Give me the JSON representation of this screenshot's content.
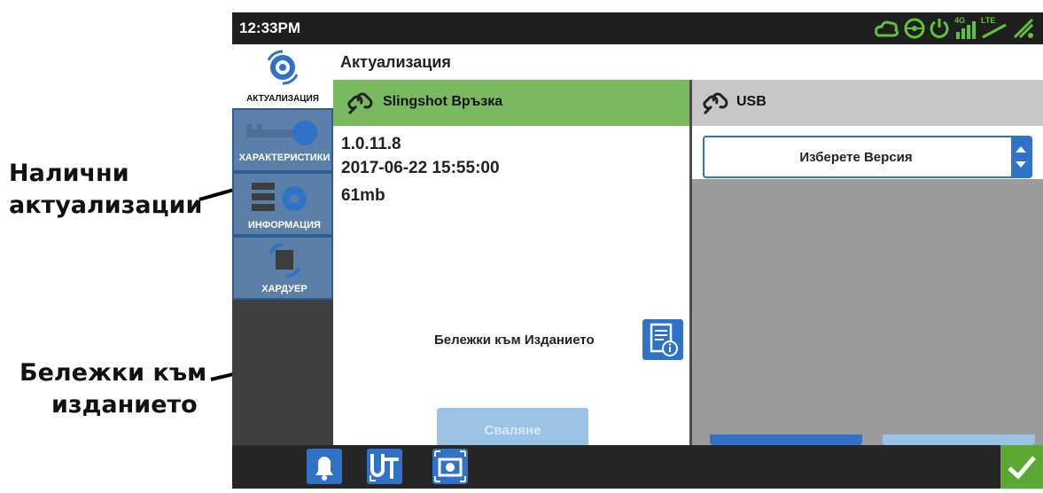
{
  "callouts": {
    "available_updates": [
      "Налични",
      "актуализации"
    ],
    "release_notes": [
      "Бележки към",
      "изданието"
    ]
  },
  "status_bar": {
    "time": "12:33PM",
    "icons": [
      "cloud-icon",
      "steering-wheel-icon",
      "power-icon",
      "signal-4g-icon",
      "lte-icon",
      "gps-icon"
    ],
    "signal_label": "4G",
    "lte_label": "LTE"
  },
  "sidebar": {
    "items": [
      {
        "label": "АКТУАЛИЗАЦИЯ",
        "icon": "gear-refresh-icon",
        "active": true
      },
      {
        "label": "ХАРАКТЕРИСТИКИ",
        "icon": "key-icon",
        "active": false
      },
      {
        "label": "ИНФОРМАЦИЯ",
        "icon": "info-list-icon",
        "active": false
      },
      {
        "label": "ХАРДУЕР",
        "icon": "chip-refresh-icon",
        "active": false
      }
    ]
  },
  "page": {
    "title": "Актуализация"
  },
  "slingshot": {
    "header": "Slingshot Връзка",
    "icon": "link-icon",
    "version": "1.0.11.8",
    "date": "2017-06-22 15:55:00",
    "size": "61mb",
    "release_notes_label": "Бележки към Изданието",
    "download_label": "Сваляне"
  },
  "usb": {
    "header": "USB",
    "icon": "usb-link-icon",
    "select_placeholder": "Изберете Версия"
  },
  "bottom_bar": {
    "icons": [
      "bell-icon",
      "ut-icon",
      "camera-icon"
    ],
    "ok_icon": "checkmark-icon"
  },
  "colors": {
    "accent_blue": "#2f73c8",
    "slingshot_green": "#79b95f",
    "ok_green": "#5aa832"
  }
}
